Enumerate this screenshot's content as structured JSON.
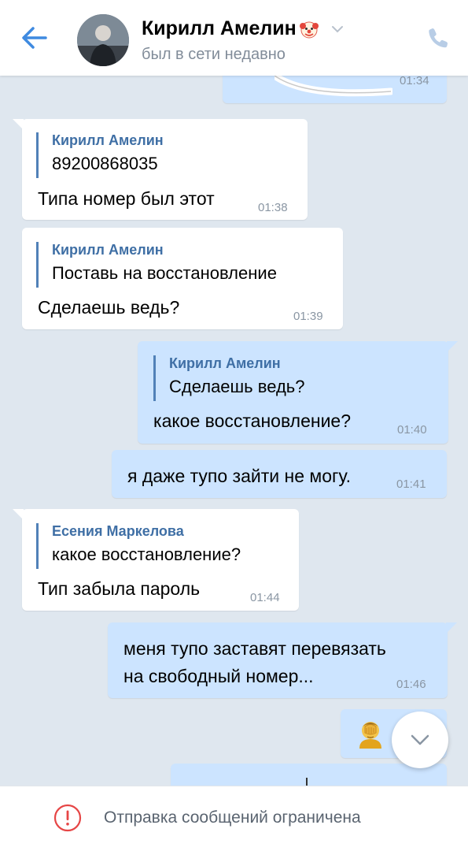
{
  "header": {
    "title": "Кирилл Амелин",
    "status": "был в сети недавно"
  },
  "messages": [
    {
      "time": "01:34"
    },
    {
      "reply_name": "Кирилл Амелин",
      "reply_text": "89200868035",
      "text": "Типа номер был этот",
      "time": "01:38"
    },
    {
      "reply_name": "Кирилл Амелин",
      "reply_text": "Поставь на восстановление",
      "text": "Сделаешь ведь?",
      "time": "01:39"
    },
    {
      "reply_name": "Кирилл Амелин",
      "reply_text": "Сделаешь ведь?",
      "text": "какое восстановление?",
      "time": "01:40"
    },
    {
      "text": "я даже тупо зайти не могу.",
      "time": "01:41"
    },
    {
      "reply_name": "Есения Маркелова",
      "reply_text": "какое восстановление?",
      "text": "Тип забыла пароль",
      "time": "01:44"
    },
    {
      "text_line1": "меня тупо заставят перевязать",
      "text_line2": "на свободный номер...",
      "time": "01:46"
    },
    {
      "emoji": "facepalm"
    }
  ],
  "bottom": {
    "text": "Отправка сообщений ограничена"
  },
  "icons": {
    "back": "back-arrow-icon",
    "phone": "phone-icon",
    "scroll": "chevron-down-icon",
    "warning": "warning-icon"
  },
  "colors": {
    "accent": "#5181b8",
    "incoming_bubble": "#ffffff",
    "outgoing_bubble": "#cce4ff",
    "background": "#dfe7ef",
    "warning": "#e64646"
  }
}
